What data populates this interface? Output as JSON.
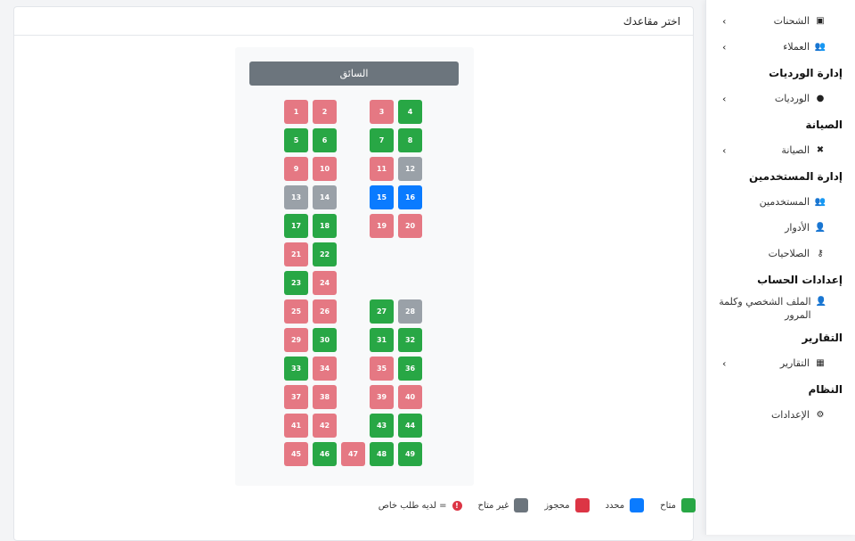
{
  "sidebar": {
    "sections": [
      {
        "type": "item",
        "icon": "box-icon",
        "glyph": "▣",
        "label": "الشحنات",
        "arrow": true
      },
      {
        "type": "item",
        "icon": "users-icon",
        "glyph": "👥",
        "label": "العملاء",
        "arrow": true
      },
      {
        "type": "head",
        "label": "إدارة الورديات"
      },
      {
        "type": "item",
        "icon": "clock-icon",
        "glyph": "●",
        "label": "الورديات",
        "arrow": true
      },
      {
        "type": "head",
        "label": "الصيانة"
      },
      {
        "type": "item",
        "icon": "tools-icon",
        "glyph": "✖",
        "label": "الصيانة",
        "arrow": true
      },
      {
        "type": "head",
        "label": "إدارة المستخدمين"
      },
      {
        "type": "item",
        "icon": "users-group-icon",
        "glyph": "👥",
        "label": "المستخدمين",
        "arrow": false
      },
      {
        "type": "item",
        "icon": "user-tag-icon",
        "glyph": "👤",
        "label": "الأدوار",
        "arrow": false
      },
      {
        "type": "item",
        "icon": "key-icon",
        "glyph": "⚷",
        "label": "الصلاحيات",
        "arrow": false
      },
      {
        "type": "head",
        "label": "إعدادات الحساب"
      },
      {
        "type": "item",
        "icon": "user-icon",
        "glyph": "👤",
        "label": "الملف الشخصي وكلمة المرور",
        "arrow": false,
        "multi": true
      },
      {
        "type": "head",
        "label": "التقارير"
      },
      {
        "type": "item",
        "icon": "chart-icon",
        "glyph": "▦",
        "label": "التقارير",
        "arrow": true
      },
      {
        "type": "head",
        "label": "النظام"
      },
      {
        "type": "item",
        "icon": "cogs-icon",
        "glyph": "⚙",
        "label": "الإعدادات",
        "arrow": false
      }
    ],
    "arrow_glyph": "›"
  },
  "card": {
    "title": "اختر مقاعدك"
  },
  "bus": {
    "driver_label": "السائق",
    "seats": [
      {
        "n": "1",
        "s": "reserved"
      },
      {
        "n": "2",
        "s": "reserved"
      },
      {
        "n": "3",
        "s": "reserved"
      },
      {
        "n": "4",
        "s": "available"
      },
      {
        "n": "5",
        "s": "available"
      },
      {
        "n": "6",
        "s": "available"
      },
      {
        "n": "7",
        "s": "available"
      },
      {
        "n": "8",
        "s": "available"
      },
      {
        "n": "9",
        "s": "reserved"
      },
      {
        "n": "10",
        "s": "reserved"
      },
      {
        "n": "11",
        "s": "reserved"
      },
      {
        "n": "12",
        "s": "unavail"
      },
      {
        "n": "13",
        "s": "unavail"
      },
      {
        "n": "14",
        "s": "unavail"
      },
      {
        "n": "15",
        "s": "selected"
      },
      {
        "n": "16",
        "s": "selected"
      },
      {
        "n": "17",
        "s": "available"
      },
      {
        "n": "18",
        "s": "available"
      },
      {
        "n": "19",
        "s": "reserved"
      },
      {
        "n": "20",
        "s": "reserved"
      },
      {
        "n": "21",
        "s": "reserved"
      },
      {
        "n": "22",
        "s": "available"
      },
      {
        "n": "23",
        "s": "available"
      },
      {
        "n": "24",
        "s": "reserved"
      },
      {
        "n": "25",
        "s": "reserved"
      },
      {
        "n": "26",
        "s": "reserved"
      },
      {
        "n": "27",
        "s": "available"
      },
      {
        "n": "28",
        "s": "unavail"
      },
      {
        "n": "29",
        "s": "reserved"
      },
      {
        "n": "30",
        "s": "available"
      },
      {
        "n": "31",
        "s": "available"
      },
      {
        "n": "32",
        "s": "available"
      },
      {
        "n": "33",
        "s": "available"
      },
      {
        "n": "34",
        "s": "reserved"
      },
      {
        "n": "35",
        "s": "reserved"
      },
      {
        "n": "36",
        "s": "available"
      },
      {
        "n": "37",
        "s": "reserved"
      },
      {
        "n": "38",
        "s": "reserved"
      },
      {
        "n": "39",
        "s": "reserved"
      },
      {
        "n": "40",
        "s": "reserved"
      },
      {
        "n": "41",
        "s": "reserved"
      },
      {
        "n": "42",
        "s": "reserved"
      },
      {
        "n": "43",
        "s": "available"
      },
      {
        "n": "44",
        "s": "available"
      },
      {
        "n": "45",
        "s": "reserved"
      },
      {
        "n": "46",
        "s": "available"
      },
      {
        "n": "47",
        "s": "reserved"
      },
      {
        "n": "48",
        "s": "available"
      },
      {
        "n": "49",
        "s": "available"
      }
    ]
  },
  "legend": {
    "available": "متاح",
    "selected": "محدد",
    "reserved": "محجوز",
    "unavailable": "غير متاح",
    "special_mark": "!",
    "special": "= لديه طلب خاص"
  },
  "colors": {
    "available": "#28a745",
    "selected": "#0a7bff",
    "reserved": "#e57883",
    "unavailable": "#9aa1a8",
    "driver": "#6c757d"
  }
}
